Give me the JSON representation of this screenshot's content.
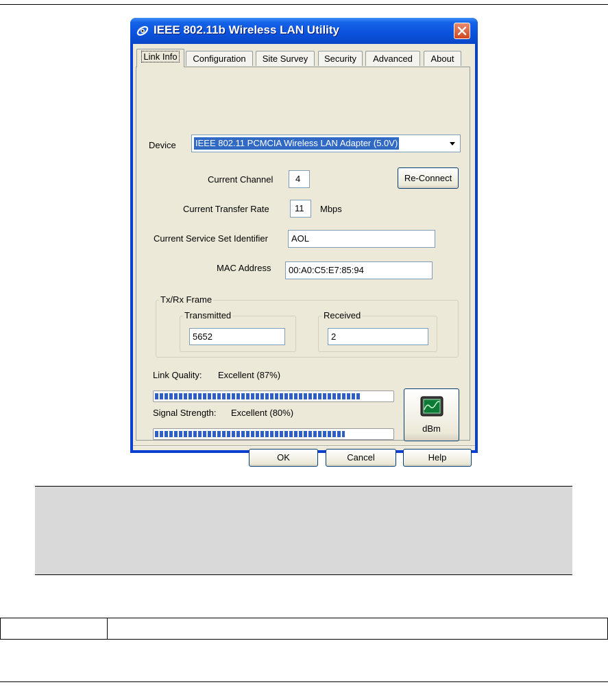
{
  "window": {
    "title": "IEEE 802.11b Wireless LAN Utility"
  },
  "tabs": [
    {
      "label": "Link Info",
      "active": true
    },
    {
      "label": "Configuration"
    },
    {
      "label": "Site Survey"
    },
    {
      "label": "Security"
    },
    {
      "label": "Advanced"
    },
    {
      "label": "About"
    }
  ],
  "link_info": {
    "device_label": "Device",
    "device_value": "IEEE 802.11 PCMCIA Wireless LAN Adapter (5.0V)",
    "channel_label": "Current Channel",
    "channel_value": "4",
    "reconnect_label": "Re-Connect",
    "rate_label": "Current Transfer Rate",
    "rate_value": "11",
    "rate_unit": "Mbps",
    "ssid_label": "Current Service Set Identifier",
    "ssid_value": "AOL",
    "mac_label": "MAC Address",
    "mac_value": "00:A0:C5:E7:85:94",
    "frame_group": "Tx/Rx Frame",
    "transmitted_label": "Transmitted",
    "transmitted_value": "5652",
    "received_label": "Received",
    "received_value": "2",
    "link_quality_label": "Link Quality:",
    "link_quality_value": "Excellent (87%)",
    "link_quality_level": 0.87,
    "signal_label": "Signal Strength:",
    "signal_value": "Excellent (80%)",
    "signal_level": 0.8,
    "dbm_label": "dBm"
  },
  "buttons": {
    "ok": "OK",
    "cancel": "Cancel",
    "help": "Help"
  },
  "colors": {
    "titlebar": "#0b52dc",
    "progress": "#2f5ec4",
    "close": "#d1461f"
  }
}
